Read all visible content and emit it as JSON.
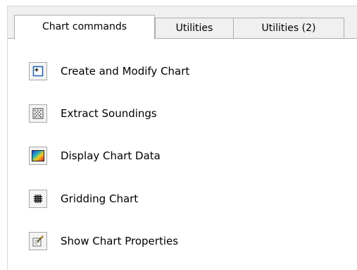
{
  "tabs": [
    {
      "label": "Chart commands",
      "active": true
    },
    {
      "label": "Utilities",
      "active": false
    },
    {
      "label": "Utilities (2)",
      "active": false
    }
  ],
  "commands": [
    {
      "label": "Create and Modify Chart",
      "icon": "create-chart-icon"
    },
    {
      "label": "Extract Soundings",
      "icon": "soundings-icon"
    },
    {
      "label": "Display Chart Data",
      "icon": "chart-data-gradient-icon"
    },
    {
      "label": "Gridding Chart",
      "icon": "grid-icon"
    },
    {
      "label": "Show Chart Properties",
      "icon": "properties-icon"
    }
  ],
  "colors": {
    "tab_border": "#adadad",
    "tab_inactive_bg": "#f0f0f0",
    "panel_bg": "#ffffff",
    "icon_accent": "#1e5fb0"
  }
}
